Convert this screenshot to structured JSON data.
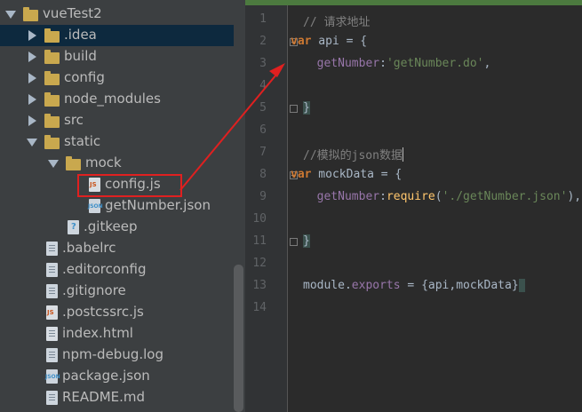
{
  "project_tree": {
    "items": [
      {
        "label": "vueTest2",
        "kind": "folder",
        "expanded": true,
        "depth": 0
      },
      {
        "label": ".idea",
        "kind": "folder",
        "expanded": false,
        "depth": 1,
        "selected": true
      },
      {
        "label": "build",
        "kind": "folder",
        "expanded": false,
        "depth": 1
      },
      {
        "label": "config",
        "kind": "folder",
        "expanded": false,
        "depth": 1
      },
      {
        "label": "node_modules",
        "kind": "folder",
        "expanded": false,
        "depth": 1
      },
      {
        "label": "src",
        "kind": "folder",
        "expanded": false,
        "depth": 1
      },
      {
        "label": "static",
        "kind": "folder",
        "expanded": true,
        "depth": 1
      },
      {
        "label": "mock",
        "kind": "folder",
        "expanded": true,
        "depth": 2
      },
      {
        "label": "config.js",
        "kind": "file",
        "icon": "js-file-icon",
        "depth": 3,
        "highlighted": true
      },
      {
        "label": "getNumber.json",
        "kind": "file",
        "icon": "json-file-icon",
        "depth": 3
      },
      {
        "label": ".gitkeep",
        "kind": "file",
        "icon": "unknown-file-icon",
        "depth": 2
      },
      {
        "label": ".babelrc",
        "kind": "file",
        "icon": "text-file-icon",
        "depth": 1
      },
      {
        "label": ".editorconfig",
        "kind": "file",
        "icon": "text-file-icon",
        "depth": 1
      },
      {
        "label": ".gitignore",
        "kind": "file",
        "icon": "text-file-icon",
        "depth": 1
      },
      {
        "label": ".postcssrc.js",
        "kind": "file",
        "icon": "js-file-icon",
        "depth": 1
      },
      {
        "label": "index.html",
        "kind": "file",
        "icon": "html-file-icon",
        "depth": 1
      },
      {
        "label": "npm-debug.log",
        "kind": "file",
        "icon": "text-file-icon",
        "depth": 1
      },
      {
        "label": "package.json",
        "kind": "file",
        "icon": "json-file-icon",
        "depth": 1
      },
      {
        "label": "README.md",
        "kind": "file",
        "icon": "text-file-icon",
        "depth": 1
      }
    ]
  },
  "editor": {
    "line_numbers": [
      "1",
      "2",
      "3",
      "4",
      "5",
      "6",
      "7",
      "8",
      "9",
      "10",
      "11",
      "12",
      "13",
      "14"
    ],
    "lines": [
      {
        "comment": "// 请求地址"
      },
      {
        "kw": "var",
        "text": " api = {"
      },
      {
        "prop": "getNumber",
        "text": ":",
        "str": "'getNumber.do'",
        "tail": ","
      },
      {
        "text": ""
      },
      {
        "brace": "}"
      },
      {
        "text": ""
      },
      {
        "comment": "//模拟的json数据"
      },
      {
        "kw": "var",
        "text": " mockData = {"
      },
      {
        "prop": "getNumber",
        "text": ":",
        "fn": "require",
        "open": "(",
        "str": "'./getNumber.json'",
        "tail": "),"
      },
      {
        "text": ""
      },
      {
        "brace": "}"
      },
      {
        "text": ""
      },
      {
        "text": "module.",
        "prop": "exports",
        "tail": " = {api,mockData}"
      },
      {
        "text": ""
      }
    ]
  },
  "colors": {
    "accent_red": "#e02020",
    "selection": "#0d293e",
    "folder": "#c9a84e"
  }
}
